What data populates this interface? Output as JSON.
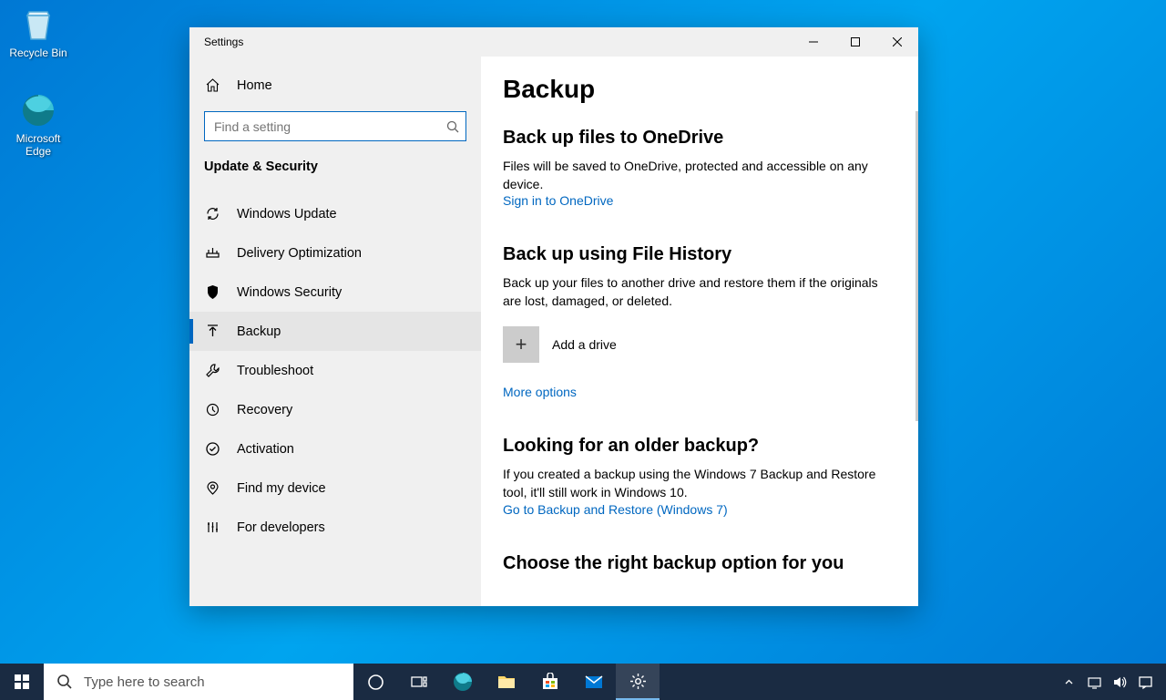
{
  "desktop": {
    "icons": [
      {
        "label": "Recycle Bin"
      },
      {
        "label": "Microsoft Edge"
      }
    ]
  },
  "window": {
    "title": "Settings",
    "home_label": "Home",
    "search_placeholder": "Find a setting",
    "category": "Update & Security",
    "nav": [
      {
        "label": "Windows Update"
      },
      {
        "label": "Delivery Optimization"
      },
      {
        "label": "Windows Security"
      },
      {
        "label": "Backup"
      },
      {
        "label": "Troubleshoot"
      },
      {
        "label": "Recovery"
      },
      {
        "label": "Activation"
      },
      {
        "label": "Find my device"
      },
      {
        "label": "For developers"
      }
    ]
  },
  "content": {
    "heading": "Backup",
    "onedrive": {
      "title": "Back up files to OneDrive",
      "desc": "Files will be saved to OneDrive, protected and accessible on any device.",
      "link": "Sign in to OneDrive"
    },
    "filehistory": {
      "title": "Back up using File History",
      "desc": "Back up your files to another drive and restore them if the originals are lost, damaged, or deleted.",
      "add_drive": "Add a drive",
      "more": "More options"
    },
    "older": {
      "title": "Looking for an older backup?",
      "desc": "If you created a backup using the Windows 7 Backup and Restore tool, it'll still work in Windows 10.",
      "link": "Go to Backup and Restore (Windows 7)"
    },
    "choose": {
      "title": "Choose the right backup option for you"
    }
  },
  "taskbar": {
    "search_placeholder": "Type here to search"
  }
}
